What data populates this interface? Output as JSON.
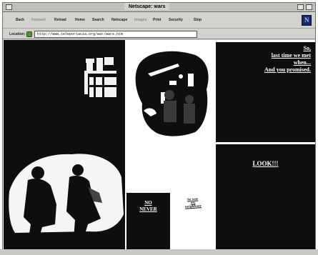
{
  "window": {
    "title": "Netscape: wars"
  },
  "toolbar": {
    "buttons": [
      {
        "label": "Back",
        "enabled": true
      },
      {
        "label": "Forward",
        "enabled": false
      },
      {
        "label": "Reload",
        "enabled": true
      },
      {
        "label": "Home",
        "enabled": true
      },
      {
        "label": "Search",
        "enabled": true
      },
      {
        "label": "Netscape",
        "enabled": true
      },
      {
        "label": "Images",
        "enabled": false
      },
      {
        "label": "Print",
        "enabled": true
      },
      {
        "label": "Security",
        "enabled": true
      },
      {
        "label": "Stop",
        "enabled": true
      }
    ],
    "logo_letter": "N"
  },
  "location": {
    "label": "Location:",
    "url": "http://www.teleportacia.org/war/wars.htm"
  },
  "frames": {
    "poem": {
      "line1": "So,",
      "line2": "last time we met",
      "line3": "when...",
      "line4": "And you promised."
    },
    "look": "LOOK!!!",
    "no_never": {
      "line1": "NO",
      "line2": "NEVER"
    },
    "scribble": {
      "line1": "he was",
      "line2": "my",
      "line3": "neighbour"
    }
  },
  "colors": {
    "frame_black": "#0e0e0e",
    "chrome": "#d4d2cc",
    "text_on_black": "#ffffff"
  }
}
